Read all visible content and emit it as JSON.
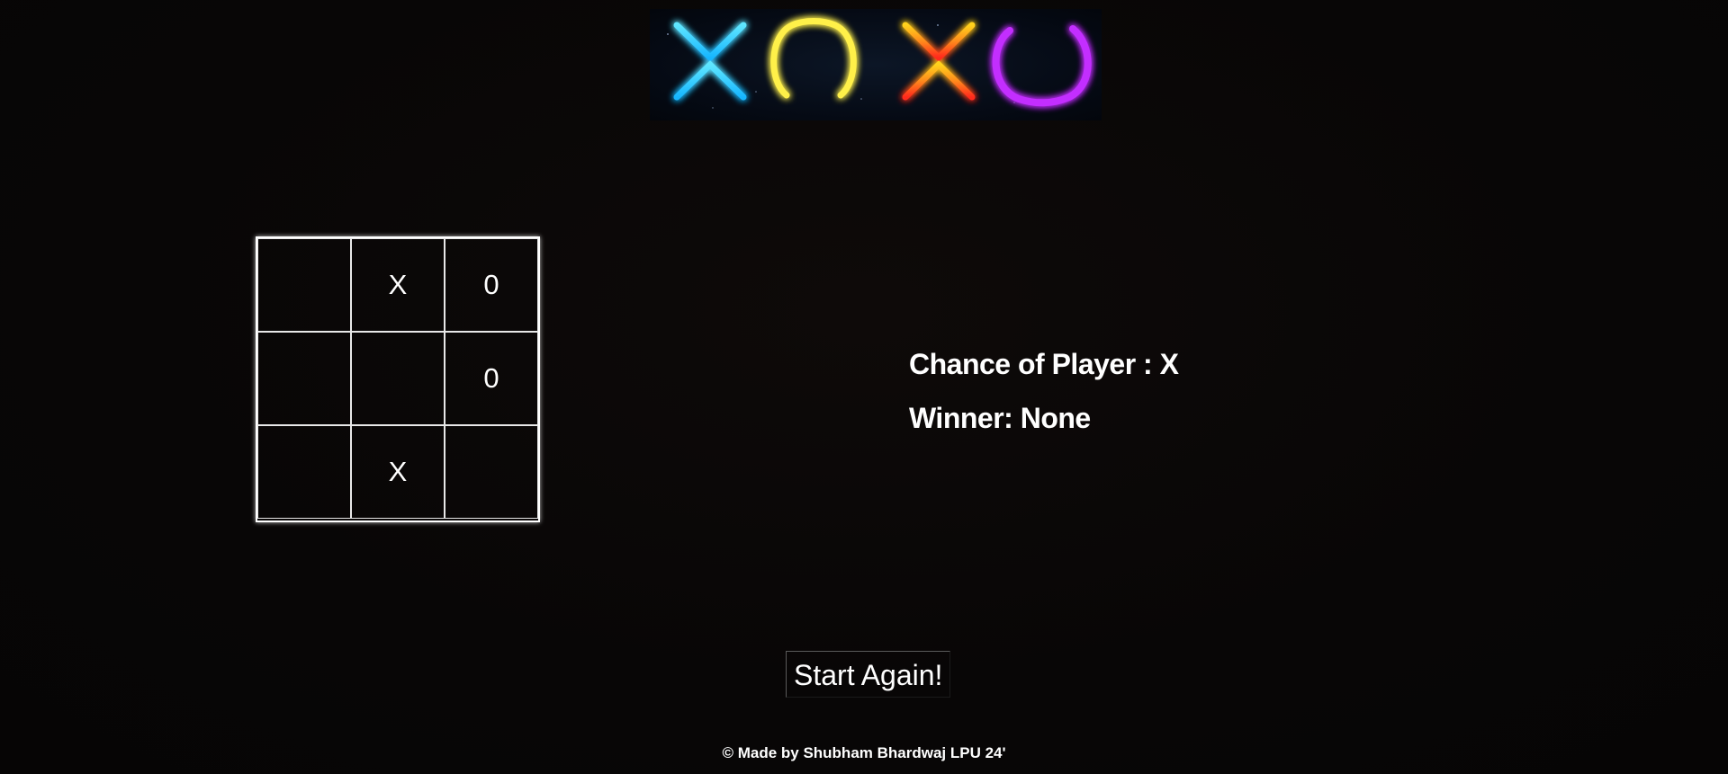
{
  "banner": {
    "glyphs": [
      {
        "icon": "neon-x-icon",
        "colors": [
          "#5fe6ff",
          "#17b6ff"
        ]
      },
      {
        "icon": "neon-o-icon",
        "colors": [
          "#fff04a",
          "#f2d21c"
        ]
      },
      {
        "icon": "neon-x-icon",
        "colors": [
          "#ffd21a",
          "#ff2a1a"
        ]
      },
      {
        "icon": "neon-o-icon",
        "colors": [
          "#d23dff",
          "#a218ff"
        ]
      }
    ]
  },
  "board": {
    "cells": [
      "",
      "X",
      "0",
      "",
      "",
      "0",
      "",
      "X",
      ""
    ]
  },
  "status": {
    "turn_text": "Chance of Player : X",
    "winner_text": "Winner: None"
  },
  "controls": {
    "reset_label": "Start Again!"
  },
  "footer": {
    "credit": "© Made by Shubham Bhardwaj LPU 24'"
  },
  "colors": {
    "background": "#090707",
    "grid_lines": "#ffffff",
    "text": "#ffffff"
  }
}
